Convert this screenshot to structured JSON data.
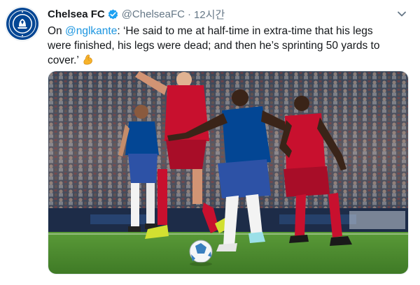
{
  "account": {
    "name": "Chelsea FC",
    "handle": "@ChelseaFC",
    "separator": "·",
    "time": "12시간"
  },
  "icons": {
    "avatar": "chelsea-crest-icon",
    "verified": "verified-badge-icon",
    "menu": "chevron-down-icon",
    "emoji": "flexed-biceps-icon"
  },
  "tweet": {
    "prefix": "On ",
    "mention": "@nglkante",
    "quote": ": ‘He said to me at half-time in extra-time that his legs were finished, his legs were dead; and then he’s sprinting 50 yards to cover.’ "
  },
  "colors": {
    "link": "#1b95e0",
    "verified": "#1da1f2",
    "chelsea_blue": "#034694",
    "liverpool_red": "#c8102e",
    "pitch": "#4f8a2e"
  },
  "media": {
    "description_icon": "match-photo"
  }
}
